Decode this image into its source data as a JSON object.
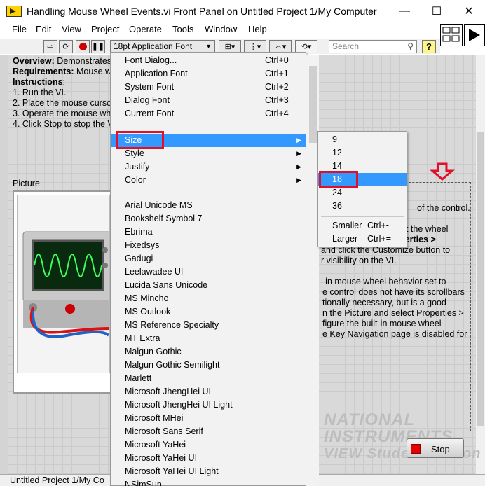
{
  "window": {
    "title": "Handling Mouse Wheel Events.vi Front Panel on Untitled Project 1/My Computer",
    "minimize": "—",
    "maximize": "☐",
    "close": "✕"
  },
  "menubar": [
    "File",
    "Edit",
    "View",
    "Project",
    "Operate",
    "Tools",
    "Window",
    "Help"
  ],
  "toolbar": {
    "font_selector": "18pt Application Font",
    "search_placeholder": "Search",
    "help": "?"
  },
  "panel": {
    "overview_lines": [
      {
        "bold": "Overview:",
        "text": " Demonstrates"
      },
      {
        "bold": "Requirements:",
        "text": " Mouse w"
      },
      {
        "bold": "Instructions",
        "text": ":"
      },
      {
        "bold": "",
        "text": "1. Run the VI."
      },
      {
        "bold": "",
        "text": "2. Place the mouse curso"
      },
      {
        "bold": "",
        "text": "3. Operate the mouse wh"
      },
      {
        "bold": "",
        "text": "4. Click Stop to stop the V"
      }
    ],
    "picture_label": "Picture",
    "description_lines": [
      "of the control.",
      "",
      "at the wheel",
      "perties >",
      "and click the Customize button to",
      "r visibility on the VI.",
      "",
      "-in mouse wheel behavior set to",
      "e control does not have its scrollbars",
      "tionally necessary, but is a good",
      "n the Picture and select Properties >",
      "figure the built-in mouse wheel",
      "e Key Navigation page is disabled for"
    ],
    "watermark_lines": [
      "NATIONAL",
      "INSTRUMENTS",
      "VIEW Student Edition"
    ],
    "stop_button": "Stop",
    "status": "Untitled Project 1/My Co"
  },
  "font_menu": {
    "top_items": [
      {
        "label": "Font Dialog...",
        "shortcut": "Ctrl+0"
      },
      {
        "label": "Application Font",
        "shortcut": "Ctrl+1"
      },
      {
        "label": "System Font",
        "shortcut": "Ctrl+2"
      },
      {
        "label": "Dialog Font",
        "shortcut": "Ctrl+3"
      },
      {
        "label": "Current Font",
        "shortcut": "Ctrl+4"
      }
    ],
    "submenus": [
      "Size",
      "Style",
      "Justify",
      "Color"
    ],
    "fonts": [
      "Arial Unicode MS",
      "Bookshelf Symbol 7",
      "Ebrima",
      "Fixedsys",
      "Gadugi",
      "Leelawadee UI",
      "Lucida Sans Unicode",
      "MS Mincho",
      "MS Outlook",
      "MS Reference Specialty",
      "MT Extra",
      "Malgun Gothic",
      "Malgun Gothic Semilight",
      "Marlett",
      "Microsoft JhengHei UI",
      "Microsoft JhengHei UI Light",
      "Microsoft MHei",
      "Microsoft Sans Serif",
      "Microsoft YaHei",
      "Microsoft YaHei UI",
      "Microsoft YaHei UI Light",
      "NSimSun"
    ]
  },
  "size_menu": {
    "sizes": [
      "9",
      "12",
      "14",
      "18",
      "24",
      "36"
    ],
    "selected": "18",
    "smaller": {
      "label": "Smaller",
      "shortcut": "Ctrl+-"
    },
    "larger": {
      "label": "Larger",
      "shortcut": "Ctrl+="
    }
  },
  "colors": {
    "highlight": "#3399ff",
    "annotation_red": "#e0102a",
    "stop_led": "#e20000"
  }
}
